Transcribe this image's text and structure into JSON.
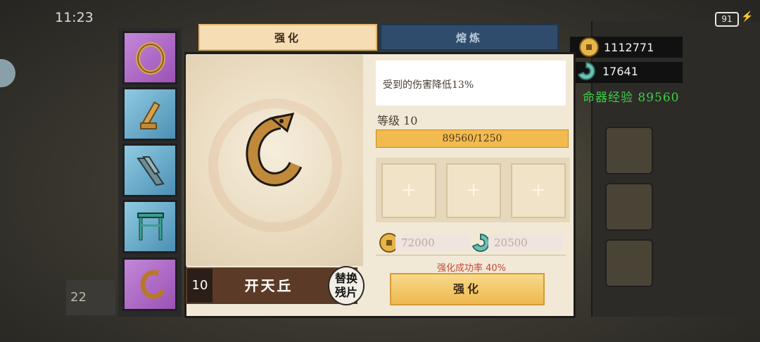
{
  "status": {
    "time": "11:23",
    "battery": "91"
  },
  "tabs": {
    "enhance": "强化",
    "smelt": "熔炼"
  },
  "currency": {
    "coins": "1112771",
    "jade": "17641",
    "exp_text": "命器经验 89560"
  },
  "item": {
    "description": "受到的伤害降低13%",
    "level_text": "等级 10",
    "exp_progress": "89560/1250",
    "level_number": "10",
    "name": "开天丘"
  },
  "material_slots": [
    "+",
    "+",
    "+"
  ],
  "cost": {
    "coins": "72000",
    "jade": "20500"
  },
  "success_rate": "强化成功率 40%",
  "buttons": {
    "enhance": "强化",
    "replace_line1": "替换",
    "replace_line2": "残片"
  },
  "background": {
    "left_number": "22"
  },
  "icons": [
    "ring-icon",
    "dagger-hilt-icon",
    "blades-icon",
    "gate-icon",
    "hook-icon",
    "coin-icon",
    "jade-icon",
    "battery-icon"
  ],
  "colors": {
    "tab_active": "#f6ddb3",
    "tab_inactive": "#2f4c6d",
    "exp_bar": "#f2bb4f",
    "exp_text": "#3fcf4a",
    "rate_text": "#c24a3a"
  }
}
